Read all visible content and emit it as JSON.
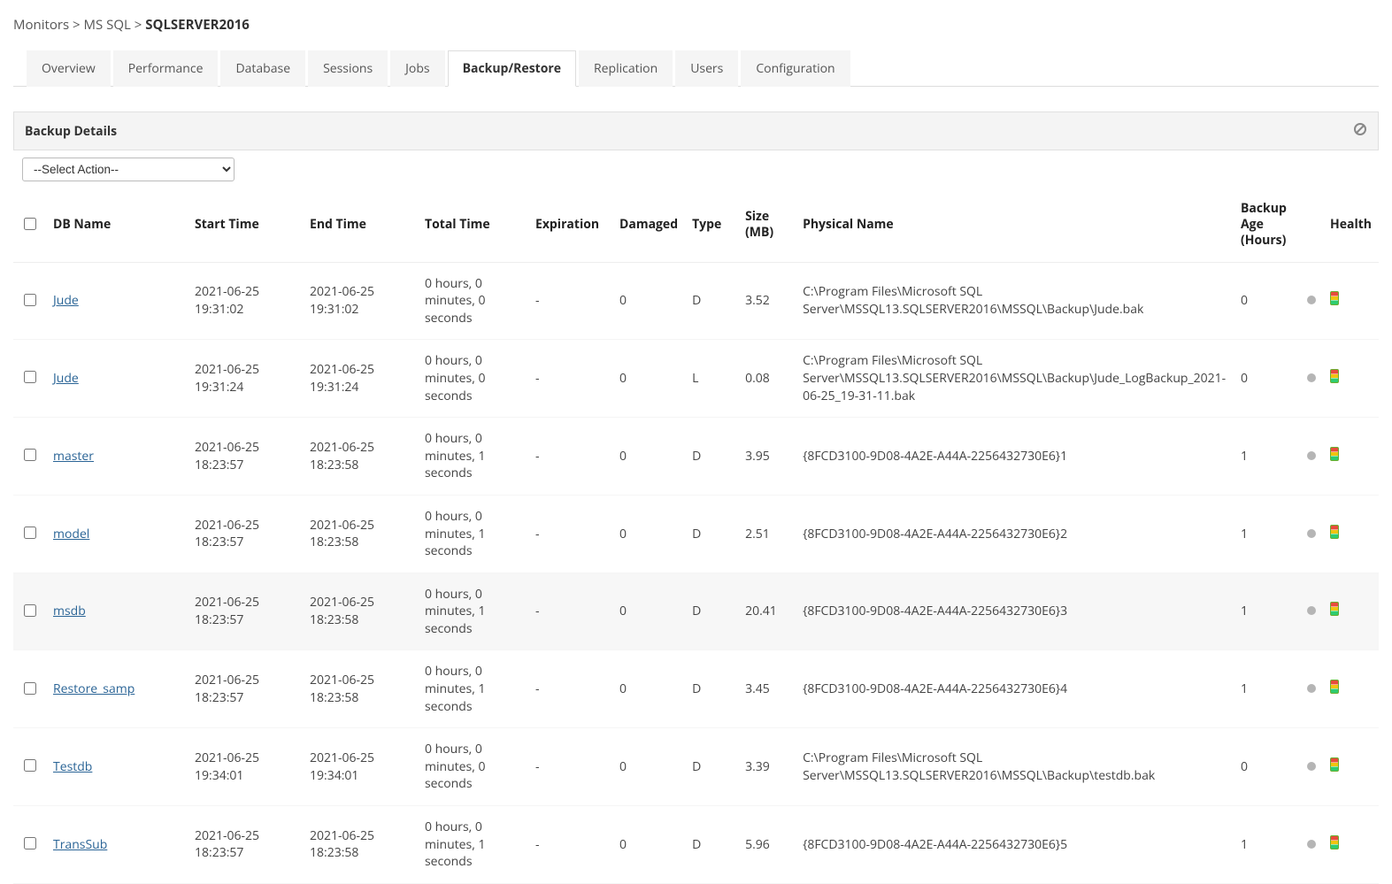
{
  "breadcrumb": {
    "root": "Monitors",
    "level1": "MS SQL",
    "current": "SQLSERVER2016"
  },
  "tabs": [
    {
      "label": "Overview",
      "active": false
    },
    {
      "label": "Performance",
      "active": false
    },
    {
      "label": "Database",
      "active": false
    },
    {
      "label": "Sessions",
      "active": false
    },
    {
      "label": "Jobs",
      "active": false
    },
    {
      "label": "Backup/Restore",
      "active": true
    },
    {
      "label": "Replication",
      "active": false
    },
    {
      "label": "Users",
      "active": false
    },
    {
      "label": "Configuration",
      "active": false
    }
  ],
  "panel": {
    "title": "Backup Details"
  },
  "action_select": {
    "placeholder": "--Select Action--"
  },
  "columns": {
    "db": "DB Name",
    "start": "Start Time",
    "end": "End Time",
    "total": "Total Time",
    "exp": "Expiration",
    "dmg": "Damaged",
    "type": "Type",
    "size": "Size (MB)",
    "phys": "Physical Name",
    "age": "Backup Age (Hours)",
    "health": "Health"
  },
  "rows": [
    {
      "db": "Jude",
      "start": "2021-06-25 19:31:02",
      "end": "2021-06-25 19:31:02",
      "total": "0 hours, 0 minutes, 0 seconds",
      "exp": "-",
      "dmg": "0",
      "type": "D",
      "size": "3.52",
      "phys": "C:\\Program Files\\Microsoft SQL Server\\MSSQL13.SQLSERVER2016\\MSSQL\\Backup\\Jude.bak",
      "age": "0",
      "highlight": false
    },
    {
      "db": "Jude",
      "start": "2021-06-25 19:31:24",
      "end": "2021-06-25 19:31:24",
      "total": "0 hours, 0 minutes, 0 seconds",
      "exp": "-",
      "dmg": "0",
      "type": "L",
      "size": "0.08",
      "phys": "C:\\Program Files\\Microsoft SQL Server\\MSSQL13.SQLSERVER2016\\MSSQL\\Backup\\Jude_LogBackup_2021-06-25_19-31-11.bak",
      "age": "0",
      "highlight": false
    },
    {
      "db": "master",
      "start": "2021-06-25 18:23:57",
      "end": "2021-06-25 18:23:58",
      "total": "0 hours, 0 minutes, 1 seconds",
      "exp": "-",
      "dmg": "0",
      "type": "D",
      "size": "3.95",
      "phys": "{8FCD3100-9D08-4A2E-A44A-2256432730E6}1",
      "age": "1",
      "highlight": false
    },
    {
      "db": "model",
      "start": "2021-06-25 18:23:57",
      "end": "2021-06-25 18:23:58",
      "total": "0 hours, 0 minutes, 1 seconds",
      "exp": "-",
      "dmg": "0",
      "type": "D",
      "size": "2.51",
      "phys": "{8FCD3100-9D08-4A2E-A44A-2256432730E6}2",
      "age": "1",
      "highlight": false
    },
    {
      "db": "msdb",
      "start": "2021-06-25 18:23:57",
      "end": "2021-06-25 18:23:58",
      "total": "0 hours, 0 minutes, 1 seconds",
      "exp": "-",
      "dmg": "0",
      "type": "D",
      "size": "20.41",
      "phys": "{8FCD3100-9D08-4A2E-A44A-2256432730E6}3",
      "age": "1",
      "highlight": true
    },
    {
      "db": "Restore_samp",
      "start": "2021-06-25 18:23:57",
      "end": "2021-06-25 18:23:58",
      "total": "0 hours, 0 minutes, 1 seconds",
      "exp": "-",
      "dmg": "0",
      "type": "D",
      "size": "3.45",
      "phys": "{8FCD3100-9D08-4A2E-A44A-2256432730E6}4",
      "age": "1",
      "highlight": false
    },
    {
      "db": "Testdb",
      "start": "2021-06-25 19:34:01",
      "end": "2021-06-25 19:34:01",
      "total": "0 hours, 0 minutes, 0 seconds",
      "exp": "-",
      "dmg": "0",
      "type": "D",
      "size": "3.39",
      "phys": "C:\\Program Files\\Microsoft SQL Server\\MSSQL13.SQLSERVER2016\\MSSQL\\Backup\\testdb.bak",
      "age": "0",
      "highlight": false
    },
    {
      "db": "TransSub",
      "start": "2021-06-25 18:23:57",
      "end": "2021-06-25 18:23:58",
      "total": "0 hours, 0 minutes, 1 seconds",
      "exp": "-",
      "dmg": "0",
      "type": "D",
      "size": "5.96",
      "phys": "{8FCD3100-9D08-4A2E-A44A-2256432730E6}5",
      "age": "1",
      "highlight": false
    }
  ]
}
